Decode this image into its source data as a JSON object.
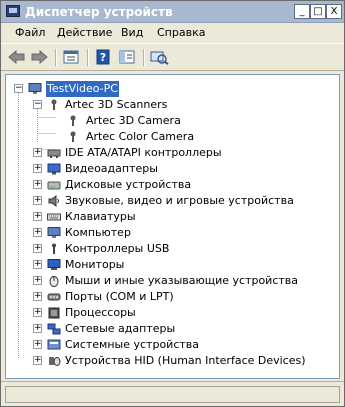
{
  "window": {
    "title": "Диспетчер устройств",
    "buttons": [
      {
        "name": "minimize-button",
        "glyph": "_"
      },
      {
        "name": "maximize-button",
        "glyph": "□"
      },
      {
        "name": "close-button",
        "glyph": "X"
      }
    ]
  },
  "menu": [
    "Файл",
    "Действие",
    "Вид",
    "Справка"
  ],
  "toolbar": {
    "items": [
      {
        "name": "back-button",
        "icon": "arrow-left-icon"
      },
      {
        "name": "forward-button",
        "icon": "arrow-right-icon"
      },
      {
        "name": "properties-button",
        "icon": "properties-icon"
      },
      {
        "name": "help-button",
        "icon": "help-icon"
      },
      {
        "name": "view-button",
        "icon": "view-icon"
      },
      {
        "name": "scan-hardware-button",
        "icon": "scan-icon"
      }
    ]
  },
  "tree": {
    "root": {
      "label": "TestVideo-PC",
      "icon": "computer-icon",
      "expanded": true,
      "selected": true
    },
    "group": {
      "label": "Artec 3D Scanners",
      "icon": "scanner-icon",
      "expanded": true,
      "children": [
        "Artec 3D Camera",
        "Artec Color Camera"
      ]
    },
    "categories": [
      {
        "label": "IDE ATA/ATAPI контроллеры",
        "icon": "ide-icon"
      },
      {
        "label": "Видеоадаптеры",
        "icon": "display-adapter-icon"
      },
      {
        "label": "Дисковые устройства",
        "icon": "disk-icon"
      },
      {
        "label": "Звуковые, видео и игровые устройства",
        "icon": "sound-icon"
      },
      {
        "label": "Клавиатуры",
        "icon": "keyboard-icon"
      },
      {
        "label": "Компьютер",
        "icon": "computer-icon"
      },
      {
        "label": "Контроллеры USB",
        "icon": "usb-icon"
      },
      {
        "label": "Мониторы",
        "icon": "monitor-icon"
      },
      {
        "label": "Мыши и иные указывающие устройства",
        "icon": "mouse-icon"
      },
      {
        "label": "Порты (COM и LPT)",
        "icon": "port-icon"
      },
      {
        "label": "Процессоры",
        "icon": "processor-icon"
      },
      {
        "label": "Сетевые адаптеры",
        "icon": "network-icon"
      },
      {
        "label": "Системные устройства",
        "icon": "system-icon"
      },
      {
        "label": "Устройства HID (Human Interface Devices)",
        "icon": "hid-icon"
      }
    ]
  },
  "colors": {
    "selection": "#316ac5",
    "title_bar": "#a8b8d0",
    "border": "#7f9db9"
  }
}
